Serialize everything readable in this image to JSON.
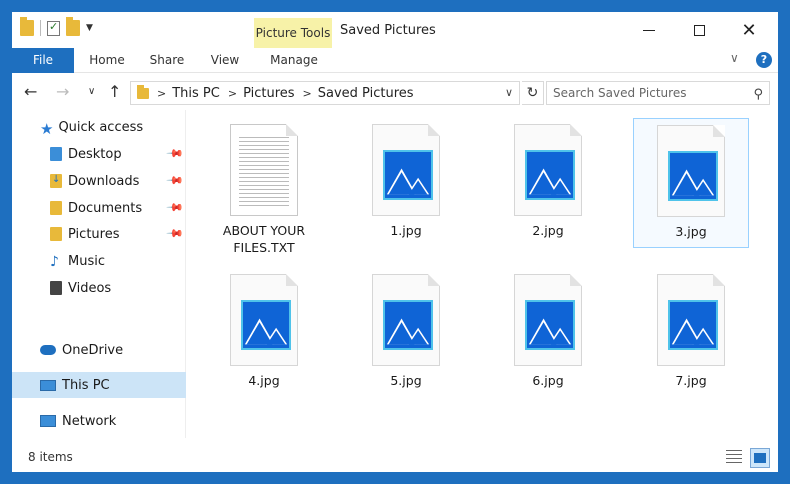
{
  "window": {
    "title": "Saved Pictures",
    "contextual_tab": "Picture Tools",
    "controls": {
      "minimize": "—",
      "maximize": "",
      "close": "✕"
    }
  },
  "ribbon": {
    "tabs": [
      {
        "label": "File",
        "active": true
      },
      {
        "label": "Home"
      },
      {
        "label": "Share"
      },
      {
        "label": "View"
      },
      {
        "label": "Manage"
      }
    ],
    "help": "?",
    "expand": "∨"
  },
  "navigation": {
    "back": "←",
    "forward": "→",
    "recent": "∨",
    "up": "↑",
    "breadcrumb": [
      "This PC",
      "Pictures",
      "Saved Pictures"
    ],
    "refresh": "↻",
    "search_placeholder": "Search Saved Pictures"
  },
  "sidebar": {
    "quick_access": "Quick access",
    "items": [
      {
        "label": "Desktop",
        "pinned": true
      },
      {
        "label": "Downloads",
        "pinned": true
      },
      {
        "label": "Documents",
        "pinned": true
      },
      {
        "label": "Pictures",
        "pinned": true
      },
      {
        "label": "Music",
        "pinned": false
      },
      {
        "label": "Videos",
        "pinned": false
      }
    ],
    "onedrive": "OneDrive",
    "this_pc": "This PC",
    "network": "Network"
  },
  "files": [
    {
      "name": "ABOUT YOUR FILES.TXT",
      "type": "txt"
    },
    {
      "name": "1.jpg",
      "type": "jpg"
    },
    {
      "name": "2.jpg",
      "type": "jpg"
    },
    {
      "name": "3.jpg",
      "type": "jpg",
      "selected": true
    },
    {
      "name": "4.jpg",
      "type": "jpg"
    },
    {
      "name": "5.jpg",
      "type": "jpg"
    },
    {
      "name": "6.jpg",
      "type": "jpg"
    },
    {
      "name": "7.jpg",
      "type": "jpg"
    }
  ],
  "status": {
    "item_count": "8 items"
  },
  "colors": {
    "accent": "#1e6fbf",
    "picture_tools_bg": "#f7f2a8",
    "selection": "#cce4f7"
  }
}
